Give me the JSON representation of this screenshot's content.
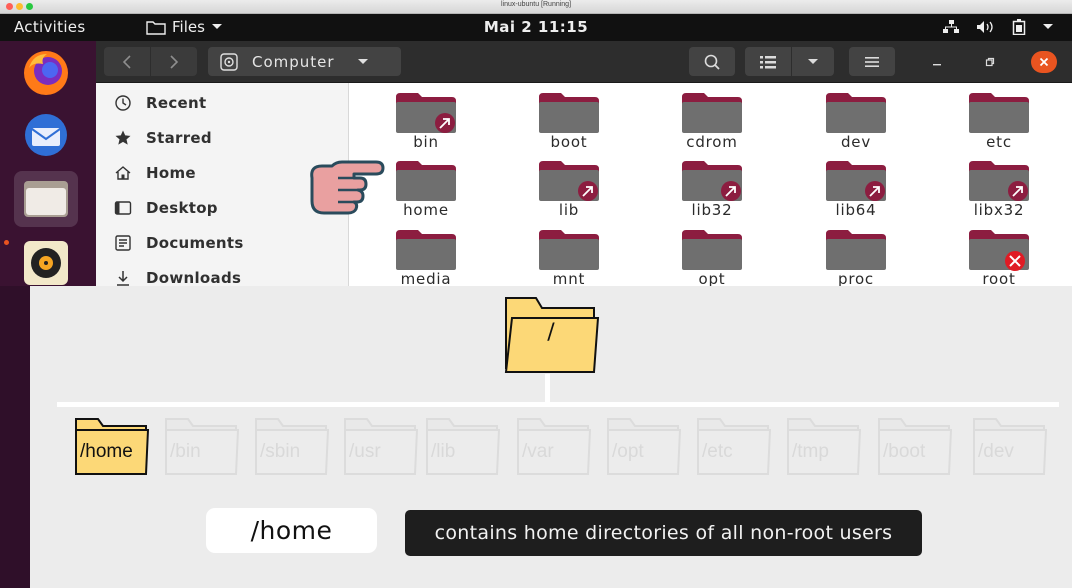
{
  "vm_window": {
    "title": "linux-ubuntu [Running]"
  },
  "topbar": {
    "activities": "Activities",
    "app_menu": "Files",
    "clock": "Mai 2  11:15"
  },
  "dock": {
    "apps": [
      "firefox-icon",
      "thunderbird-icon",
      "files-icon",
      "rhythmbox-icon"
    ]
  },
  "header": {
    "location": "Computer"
  },
  "sidebar": {
    "items": [
      {
        "label": "Recent",
        "icon": "clock-icon"
      },
      {
        "label": "Starred",
        "icon": "star-icon"
      },
      {
        "label": "Home",
        "icon": "home-icon"
      },
      {
        "label": "Desktop",
        "icon": "desktop-icon"
      },
      {
        "label": "Documents",
        "icon": "documents-icon"
      },
      {
        "label": "Downloads",
        "icon": "downloads-icon"
      }
    ]
  },
  "folders": [
    {
      "name": "bin",
      "emblem": "link"
    },
    {
      "name": "boot",
      "emblem": ""
    },
    {
      "name": "cdrom",
      "emblem": ""
    },
    {
      "name": "dev",
      "emblem": ""
    },
    {
      "name": "etc",
      "emblem": ""
    },
    {
      "name": "home",
      "emblem": ""
    },
    {
      "name": "lib",
      "emblem": "link"
    },
    {
      "name": "lib32",
      "emblem": "link"
    },
    {
      "name": "lib64",
      "emblem": "link"
    },
    {
      "name": "libx32",
      "emblem": "link"
    },
    {
      "name": "media",
      "emblem": ""
    },
    {
      "name": "mnt",
      "emblem": ""
    },
    {
      "name": "opt",
      "emblem": ""
    },
    {
      "name": "proc",
      "emblem": ""
    },
    {
      "name": "root",
      "emblem": "locked"
    }
  ],
  "overlay": {
    "root_label": "/",
    "subdirs": [
      "/home",
      "/bin",
      "/sbin",
      "/usr",
      "/lib",
      "/var",
      "/opt",
      "/etc",
      "/tmp",
      "/boot",
      "/dev"
    ],
    "highlighted": "/home",
    "pill": "/home",
    "caption": "contains home directories of all non-root users"
  },
  "colors": {
    "folder_top": "#8c1d40",
    "folder_body": "#6f6f6f",
    "folder_highlight": "#fcd877",
    "accent": "#e95420",
    "dock_bg": "#3a1231"
  }
}
